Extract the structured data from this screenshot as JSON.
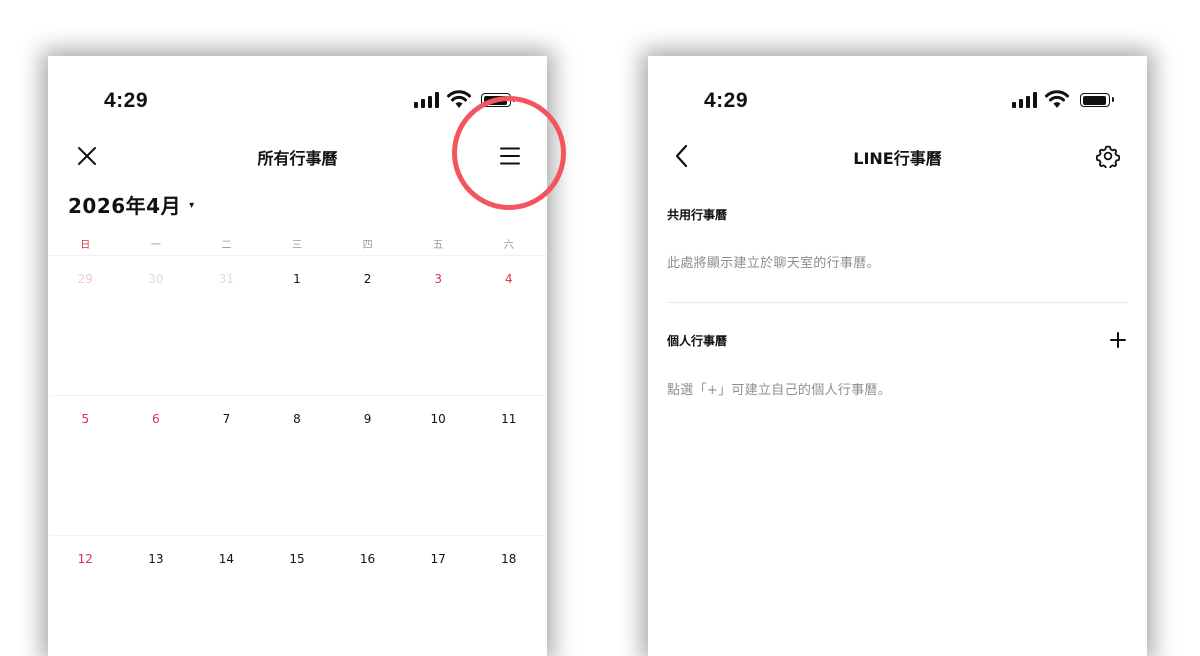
{
  "left_screen": {
    "status": {
      "time": "4:29"
    },
    "header": {
      "title": "所有行事曆",
      "close_icon": "close-icon",
      "menu_icon": "menu-icon"
    },
    "month_label": "2026年4月",
    "month_caret": "▾",
    "weekdays": [
      "日",
      "一",
      "二",
      "三",
      "四",
      "五",
      "六"
    ],
    "weeks": [
      [
        {
          "d": "29",
          "muted": true,
          "red": true
        },
        {
          "d": "30",
          "muted": true
        },
        {
          "d": "31",
          "muted": true
        },
        {
          "d": "1"
        },
        {
          "d": "2"
        },
        {
          "d": "3",
          "red": true
        },
        {
          "d": "4",
          "red": true
        }
      ],
      [
        {
          "d": "5",
          "red": true
        },
        {
          "d": "6",
          "red": true
        },
        {
          "d": "7"
        },
        {
          "d": "8"
        },
        {
          "d": "9"
        },
        {
          "d": "10"
        },
        {
          "d": "11"
        }
      ],
      [
        {
          "d": "12",
          "red": true
        },
        {
          "d": "13"
        },
        {
          "d": "14"
        },
        {
          "d": "15"
        },
        {
          "d": "16"
        },
        {
          "d": "17"
        },
        {
          "d": "18"
        }
      ]
    ]
  },
  "right_screen": {
    "status": {
      "time": "4:29"
    },
    "header": {
      "title": "LINE行事曆",
      "back_icon": "back-icon",
      "settings_icon": "gear-icon"
    },
    "shared": {
      "title": "共用行事曆",
      "empty_text": "此處將顯示建立於聊天室的行事曆。"
    },
    "personal": {
      "title": "個人行事曆",
      "add_label": "+",
      "empty_text": "點選「+」可建立自己的個人行事曆。"
    }
  },
  "colors": {
    "holiday_red": "#d9324a",
    "highlight_circle": "#f25560",
    "text": "#111111",
    "muted_text": "#8e8e8e"
  }
}
